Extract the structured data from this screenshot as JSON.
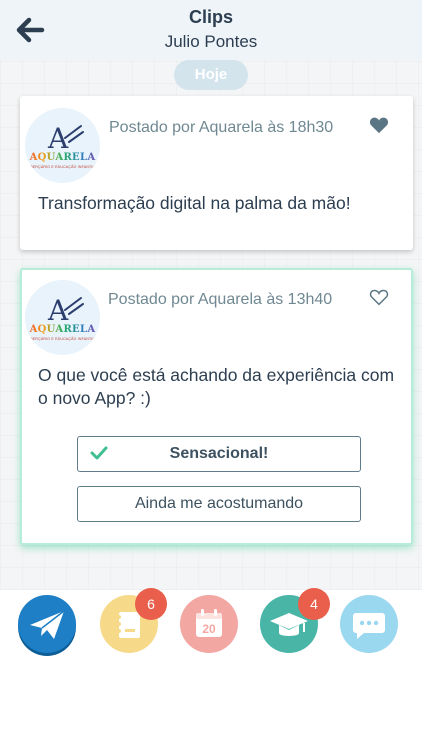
{
  "header": {
    "title": "Clips",
    "subtitle": "Julio Pontes"
  },
  "feed": {
    "date_label": "Hoje",
    "posts": [
      {
        "avatar_name": "AQUARELA",
        "avatar_tagline": "BERÇÁRIO E EDUCAÇÃO INFANTIL",
        "posted": "Postado por Aquarela às 18h30",
        "liked": true,
        "message": "Transformação digital na palma da mão!"
      },
      {
        "avatar_name": "AQUARELA",
        "avatar_tagline": "BERÇÁRIO E EDUCAÇÃO INFANTIL",
        "posted": "Postado por Aquarela às 13h40",
        "liked": false,
        "message": "O que você está achando da experiência com o novo App? :)",
        "options": [
          {
            "label": "Sensacional!",
            "selected": true
          },
          {
            "label": "Ainda me acostumando",
            "selected": false
          }
        ]
      }
    ]
  },
  "bottom_nav": {
    "items": [
      {
        "icon": "paper-plane-icon",
        "badge": ""
      },
      {
        "icon": "notebook-icon",
        "badge": "6"
      },
      {
        "icon": "calendar-icon",
        "badge": "",
        "calendar_day": "20"
      },
      {
        "icon": "graduation-cap-icon",
        "badge": "4"
      },
      {
        "icon": "chat-bubble-icon",
        "badge": ""
      }
    ]
  },
  "colors": {
    "header_bg": "#eef4f8",
    "accent_green": "#3fbf8f",
    "badge_red": "#e95f4c",
    "nav_blue": "#1e7fc6",
    "nav_yellow": "#f7d98a",
    "nav_pink": "#f3a7a2",
    "nav_teal": "#49b5a7",
    "nav_lightblue": "#9ad8f0"
  }
}
